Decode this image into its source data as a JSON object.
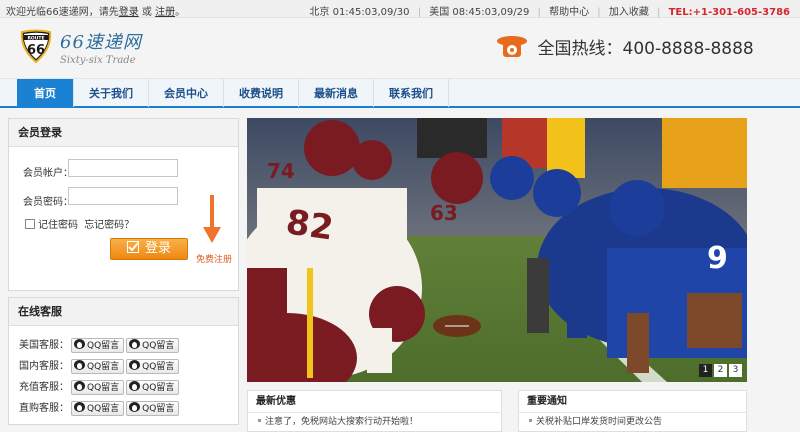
{
  "topbar": {
    "welcome_prefix": "欢迎光临66速递网，请先",
    "login_link": "登录",
    "or_text": "或",
    "register_link": "注册",
    "welcome_suffix": "。",
    "beijing_time": "北京 01:45:03,09/30",
    "us_time": "美国 08:45:03,09/29",
    "help_link": "帮助中心",
    "favorite_link": "加入收藏",
    "tel": "TEL:+1-301-605-3786"
  },
  "header": {
    "logo_badge_top": "ROUTE",
    "logo_badge_num": "66",
    "logo_cn": "66速递网",
    "logo_en": "Sixty-six Trade",
    "hotline_label": "全国热线：400-8888-8888"
  },
  "nav": {
    "items": [
      {
        "label": "首页",
        "active": true
      },
      {
        "label": "关于我们",
        "active": false
      },
      {
        "label": "会员中心",
        "active": false
      },
      {
        "label": "收费说明",
        "active": false
      },
      {
        "label": "最新消息",
        "active": false
      },
      {
        "label": "联系我们",
        "active": false
      }
    ]
  },
  "login": {
    "title": "会员登录",
    "account_label": "会员帐户：",
    "account_value": "",
    "password_label": "会员密码：",
    "password_value": "",
    "remember_label": "记住密码",
    "forgot_label": "忘记密码？",
    "login_button": "登录",
    "free_register": "免费注册"
  },
  "service": {
    "title": "在线客服",
    "qq_label": "QQ留言",
    "rows": [
      {
        "label": "美国客服："
      },
      {
        "label": "国内客服："
      },
      {
        "label": "充值客服："
      },
      {
        "label": "直购客服："
      }
    ]
  },
  "banner": {
    "pages": [
      "1",
      "2",
      "3"
    ],
    "active_page": "1",
    "jersey_left_1": "74",
    "jersey_left_2": "82",
    "jersey_left_3": "63",
    "jersey_right": "9"
  },
  "promotions": {
    "title": "最新优惠",
    "items": [
      "注意了，免税网站大搜索行动开始啦！"
    ]
  },
  "notices": {
    "title": "重要通知",
    "items": [
      "关税补贴口岸发货时间更改公告"
    ]
  },
  "colors": {
    "accent": "#1b82d3",
    "tel": "#d3262e",
    "login_button": "#ee8810"
  }
}
